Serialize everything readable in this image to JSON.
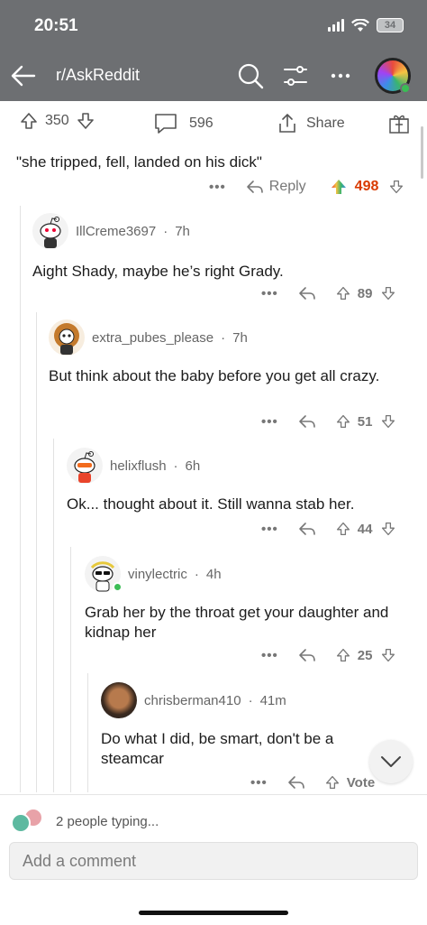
{
  "status": {
    "time": "20:51",
    "battery": "34"
  },
  "header": {
    "subreddit": "r/AskReddit"
  },
  "post_actions": {
    "upvotes": "350",
    "comments": "596",
    "share_label": "Share"
  },
  "parent": {
    "text": "\"she tripped, fell, landed on his dick\"",
    "reply_label": "Reply",
    "score": "498"
  },
  "comments": [
    {
      "author": "IllCreme3697",
      "age": "7h",
      "body": "Aight Shady, maybe he’s right Grady.",
      "score": "89"
    },
    {
      "author": "extra_pubes_please",
      "age": "7h",
      "body": "But think about the baby before you get all crazy.",
      "score": "51"
    },
    {
      "author": "helixflush",
      "age": "6h",
      "body": "Ok... thought about it. Still wanna stab her.",
      "score": "44"
    },
    {
      "author": "vinylectric",
      "age": "4h",
      "body": "Grab her by the throat get your daughter and kidnap her",
      "score": "25"
    },
    {
      "author": "chrisberman410",
      "age": "41m",
      "body": "Do what I did, be smart, don't be a steamcar",
      "score": "Vote"
    }
  ],
  "bottom": {
    "typing": "2 people typing...",
    "placeholder": "Add a comment"
  },
  "colors": {
    "header_bg": "#6d6f72",
    "score_orange": "#d93a00",
    "online_green": "#3bbd55"
  }
}
